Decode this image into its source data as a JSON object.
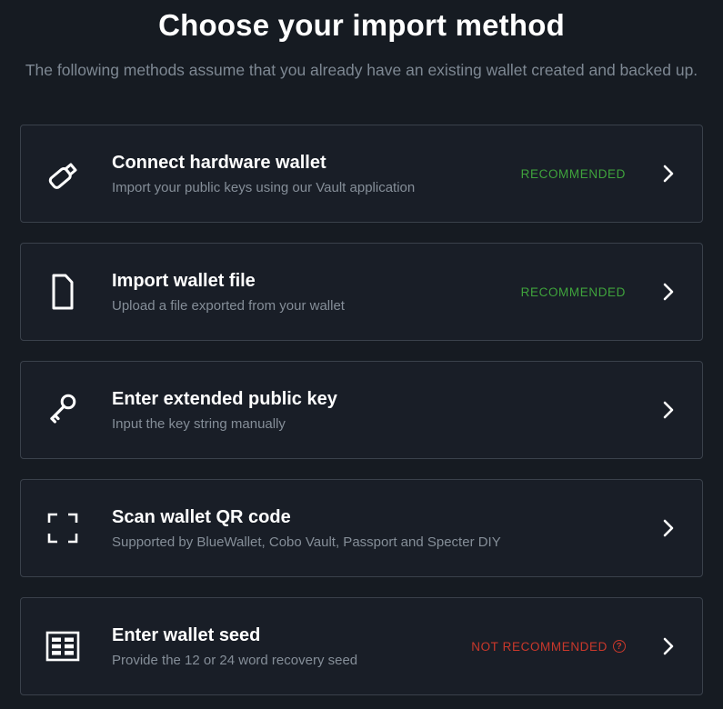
{
  "page": {
    "title": "Choose your import method",
    "subtitle": "The following methods assume that you already have an existing wallet created and backed up."
  },
  "colors": {
    "background": "#161b22",
    "card_background": "#191e27",
    "card_border": "#3a414b",
    "recommended": "#3fa33c",
    "not_recommended": "#c9382b"
  },
  "methods": [
    {
      "id": "connect-hardware-wallet",
      "icon": "usb-stick-icon",
      "title": "Connect hardware wallet",
      "description": "Import your public keys using our Vault application",
      "badge": "RECOMMENDED",
      "badge_type": "recommended",
      "badge_help": ""
    },
    {
      "id": "import-wallet-file",
      "icon": "file-icon",
      "title": "Import wallet file",
      "description": "Upload a file exported from your wallet",
      "badge": "RECOMMENDED",
      "badge_type": "recommended",
      "badge_help": ""
    },
    {
      "id": "enter-extended-public-key",
      "icon": "key-icon",
      "title": "Enter extended public key",
      "description": "Input the key string manually",
      "badge": "",
      "badge_type": "none",
      "badge_help": ""
    },
    {
      "id": "scan-wallet-qr-code",
      "icon": "qr-scan-icon",
      "title": "Scan wallet QR code",
      "description": "Supported by BlueWallet, Cobo Vault, Passport and Specter DIY",
      "badge": "",
      "badge_type": "none",
      "badge_help": ""
    },
    {
      "id": "enter-wallet-seed",
      "icon": "seed-table-icon",
      "title": "Enter wallet seed",
      "description": "Provide the 12 or 24 word recovery seed",
      "badge": "NOT RECOMMENDED",
      "badge_type": "not-recommended",
      "badge_help": "?"
    }
  ]
}
